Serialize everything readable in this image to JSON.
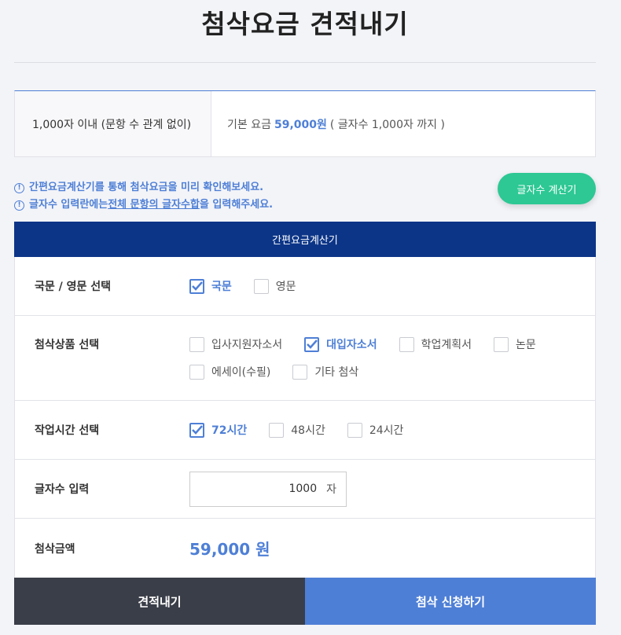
{
  "page": {
    "title": "첨삭요금 견적내기"
  },
  "price_table": {
    "label": "1,000자 이내 (문항 수 관계 없이)",
    "prefix": "기본 요금",
    "amount": "59,000원",
    "suffix": "( 글자수 1,000자 까지 )"
  },
  "notices": {
    "line1": "간편요금계산기를 통해 첨삭요금을 미리 확인해보세요.",
    "line2_prefix": "글자수 입력란에는 ",
    "line2_underline": "전체 문항의 글자수합",
    "line2_suffix": "을 입력해주세요."
  },
  "counter_button": {
    "label": "글자수 계산기"
  },
  "calc": {
    "header": "간편요금계산기",
    "language": {
      "label": "국문 / 영문 선택",
      "options": [
        {
          "label": "국문",
          "checked": true
        },
        {
          "label": "영문",
          "checked": false
        }
      ]
    },
    "product": {
      "label": "첨삭상품 선택",
      "options": [
        {
          "label": "입사지원자소서",
          "checked": false
        },
        {
          "label": "대입자소서",
          "checked": true
        },
        {
          "label": "학업계획서",
          "checked": false
        },
        {
          "label": "논문",
          "checked": false
        },
        {
          "label": "에세이(수필)",
          "checked": false
        },
        {
          "label": "기타 첨삭",
          "checked": false
        }
      ]
    },
    "time": {
      "label": "작업시간 선택",
      "options": [
        {
          "label": "72시간",
          "checked": true
        },
        {
          "label": "48시간",
          "checked": false
        },
        {
          "label": "24시간",
          "checked": false
        }
      ]
    },
    "chars": {
      "label": "글자수 입력",
      "value": "1000",
      "unit": "자"
    },
    "total": {
      "label": "첨삭금액",
      "value": "59,000 원"
    }
  },
  "footer": {
    "estimate": "견적내기",
    "apply": "첨삭 신청하기"
  },
  "colors": {
    "accent": "#4e7fd6",
    "header": "#0c3587",
    "green": "#2dc894",
    "dark": "#3a3e48"
  }
}
